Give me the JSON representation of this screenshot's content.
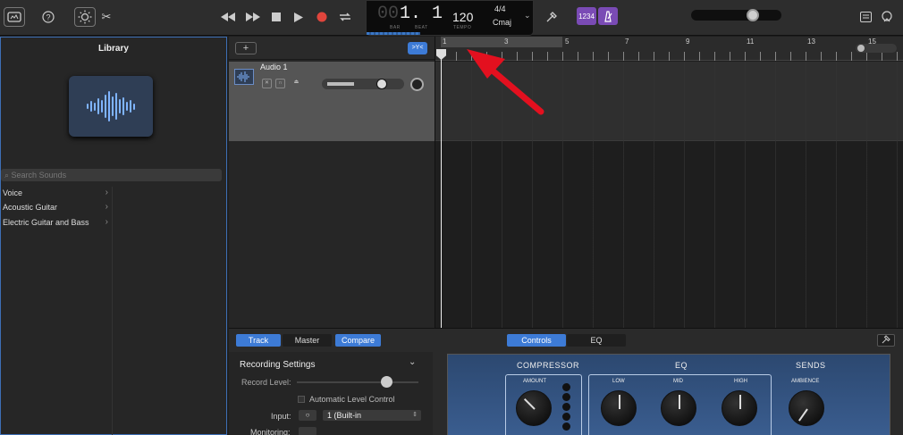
{
  "toolbar": {
    "lcd": {
      "bar_dim": "00",
      "position": "1. 1",
      "bar_label": "BAR",
      "beat_label": "BEAT",
      "tempo": "120",
      "tempo_label": "TEMPO",
      "time_signature": "4/4",
      "key": "Cmaj"
    },
    "count_in": "1234",
    "icons": [
      "library-icon",
      "help-icon",
      "brightness-icon",
      "scissors-icon",
      "rewind-icon",
      "fast-forward-icon",
      "stop-icon",
      "play-icon",
      "record-icon",
      "cycle-icon",
      "tuner-icon",
      "metronome-icon",
      "notepad-icon",
      "loop-browser-icon"
    ],
    "master_volume": 0.66
  },
  "library": {
    "title": "Library",
    "search_placeholder": "Search Sounds",
    "items": [
      "Voice",
      "Acoustic Guitar",
      "Electric Guitar and Bass"
    ]
  },
  "tracks": {
    "add_label": "+",
    "smart_label": ">Y<",
    "track": {
      "name": "Audio 1",
      "volume": 0.67
    }
  },
  "ruler": {
    "bars": [
      "1",
      "3",
      "5",
      "7",
      "9",
      "11",
      "13",
      "15"
    ]
  },
  "bottom": {
    "tabs": {
      "track": "Track",
      "master": "Master",
      "compare": "Compare"
    },
    "view_tabs": {
      "controls": "Controls",
      "eq": "EQ"
    },
    "recording_settings": "Recording Settings",
    "record_level": "Record Level:",
    "auto_level": "Automatic Level Control",
    "input_label": "Input:",
    "input_value": "1 (Built-in",
    "monitoring_label": "Monitoring:",
    "plugin": {
      "compressor": "COMPRESSOR",
      "eq": "EQ",
      "sends": "SENDS",
      "amount": "AMOUNT",
      "low": "LOW",
      "mid": "MID",
      "high": "HIGH",
      "ambience": "AMBIENCE"
    }
  },
  "colors": {
    "accent": "#3d7bd6",
    "record": "#e0453c",
    "purple": "#7a4bb5",
    "annotation_arrow": "#e3101f"
  }
}
